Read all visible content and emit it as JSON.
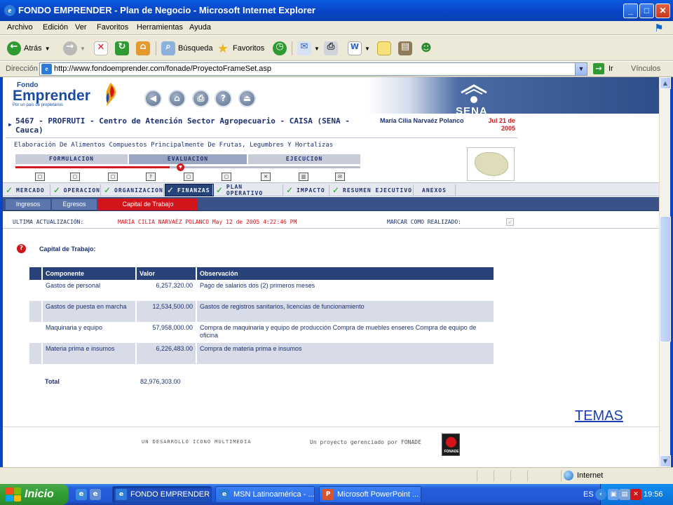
{
  "window": {
    "title": "FONDO EMPRENDER - Plan de Negocio - Microsoft Internet Explorer",
    "minimize": "_",
    "maximize": "□",
    "close": "✕"
  },
  "menubar": {
    "items": [
      "Archivo",
      "Edición",
      "Ver",
      "Favoritos",
      "Herramientas",
      "Ayuda"
    ]
  },
  "toolbar": {
    "back_label": "Atrás",
    "search_label": "Búsqueda",
    "favorites_label": "Favoritos"
  },
  "address": {
    "label": "Dirección",
    "url": "http://www.fondoemprender.com/fonade/ProyectoFrameSet.asp",
    "go_label": "Ir",
    "links_label": "Vínculos"
  },
  "site": {
    "logo_small": "Fondo",
    "logo_big": "Emprender",
    "tagline": "Por un país de propietarios",
    "sena": "SENA"
  },
  "project": {
    "title": "5467 - PROFRUTI - Centro de Atención Sector Agropecuario - CAISA (SENA - Cauca)",
    "user": "María Cilia Narvaéz Polanco",
    "date": "Jul 21 de 2005",
    "subtitle": "Elaboración De Alimentos Compuestos Principalmente De Frutas, Legumbres Y Hortalizas"
  },
  "phases": [
    "FORMULACION",
    "EVALUACION",
    "EJECUCION"
  ],
  "modules": [
    {
      "label": "MERCADO"
    },
    {
      "label": "OPERACION"
    },
    {
      "label": "ORGANIZACION"
    },
    {
      "label": "FINANZAS"
    },
    {
      "label": "PLAN OPERATIVO"
    },
    {
      "label": "IMPACTO"
    },
    {
      "label": "RESUMEN EJECUTIVO"
    },
    {
      "label": "ANEXOS"
    }
  ],
  "subtabs": [
    "Ingresos",
    "Egresos",
    "Capital de Trabajo"
  ],
  "update": {
    "label": "ULTIMA ACTUALIZACIÓN:",
    "value": "MARÍA CILIA NARVAÉZ POLANCO  May 12 de 2005 4:22:46 PM",
    "mark_label": "MARCAR COMO REALIZADO:",
    "mark_checked": true
  },
  "section": {
    "title": "Capital de Trabajo:"
  },
  "table": {
    "headers": [
      "Componente",
      "Valor",
      "Observación"
    ],
    "rows": [
      {
        "componente": "Gastos de personal",
        "valor": "6,257,320.00",
        "observacion": "Pago de salarios dos (2) primeros meses"
      },
      {
        "componente": "Gastos de puesta en marcha",
        "valor": "12,534,500.00",
        "observacion": "Gastos de registros sanitarios, licencias de funcionamiento"
      },
      {
        "componente": "Maquinaria y equipo",
        "valor": "57,958,000.00",
        "observacion": "Compra de maquinaria y equipo de producción Compra de muebles enseres Compra de equipo de oficina"
      },
      {
        "componente": "Materia prima e insumos",
        "valor": "6,226,483.00",
        "observacion": "Compra de materia prima e insumos"
      }
    ],
    "total_label": "Total",
    "total_value": "82,976,303.00"
  },
  "temas_link": "TEMAS",
  "footer": {
    "credit": "UN DESARROLLO ICONO MULTIMEDIA",
    "managed": "Un proyecto gerenciado por  FONADE",
    "fonade_logo": "FONADE"
  },
  "statusbar": {
    "zone": "Internet"
  },
  "taskbar": {
    "start": "Inicio",
    "tasks": [
      "FONDO EMPRENDER ...",
      "MSN Latinoamérica - ...",
      "Microsoft PowerPoint ..."
    ],
    "lang": "ES",
    "clock": "19:56"
  },
  "colors": {
    "accent_red": "#d1151b",
    "navy": "#27437a",
    "xp_blue": "#0a5ae0"
  }
}
